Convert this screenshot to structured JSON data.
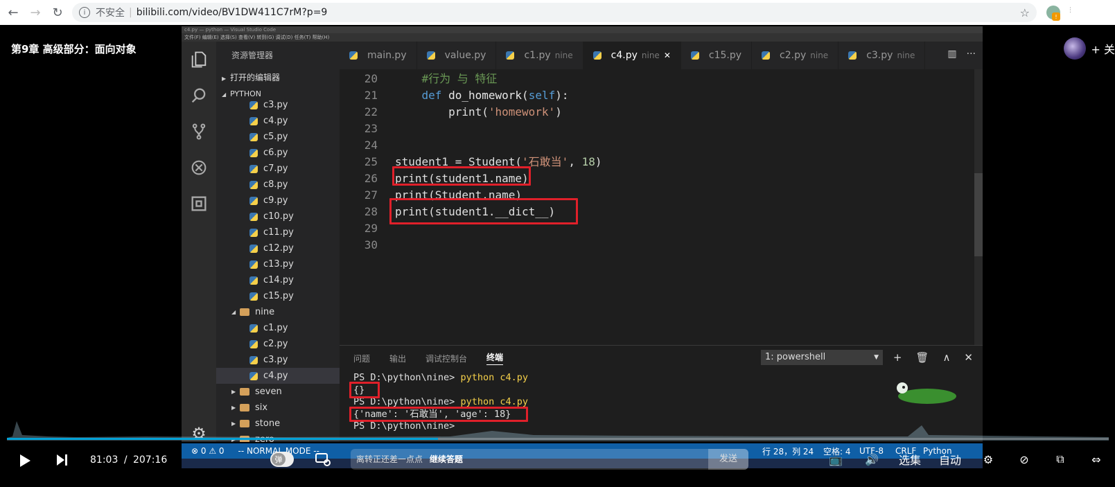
{
  "browser": {
    "insecure_label": "不安全",
    "url": "bilibili.com/video/BV1DW411C7rM?p=9"
  },
  "video": {
    "title": "第9章 高级部分：面向对象",
    "follow_label": "+ 关"
  },
  "vscode": {
    "titlebar": "c4.py — python — Visual Studio Code",
    "menubar": "文件(F)  编辑(E)  选择(S)  查看(V)  转到(G)  调试(D)  任务(T)  帮助(H)",
    "explorer_title": "资源管理器",
    "open_editors": "打开的编辑器",
    "workspace": "PYTHON",
    "tree": [
      {
        "label": "c3.py",
        "type": "py",
        "indent": 2
      },
      {
        "label": "c4.py",
        "type": "py",
        "indent": 2
      },
      {
        "label": "c5.py",
        "type": "py",
        "indent": 2
      },
      {
        "label": "c6.py",
        "type": "py",
        "indent": 2
      },
      {
        "label": "c7.py",
        "type": "py",
        "indent": 2
      },
      {
        "label": "c8.py",
        "type": "py",
        "indent": 2
      },
      {
        "label": "c9.py",
        "type": "py",
        "indent": 2
      },
      {
        "label": "c10.py",
        "type": "py",
        "indent": 2
      },
      {
        "label": "c11.py",
        "type": "py",
        "indent": 2
      },
      {
        "label": "c12.py",
        "type": "py",
        "indent": 2
      },
      {
        "label": "c13.py",
        "type": "py",
        "indent": 2
      },
      {
        "label": "c14.py",
        "type": "py",
        "indent": 2
      },
      {
        "label": "c15.py",
        "type": "py",
        "indent": 2
      },
      {
        "label": "nine",
        "type": "folder-open",
        "indent": 1
      },
      {
        "label": "c1.py",
        "type": "py",
        "indent": 2
      },
      {
        "label": "c2.py",
        "type": "py",
        "indent": 2
      },
      {
        "label": "c3.py",
        "type": "py",
        "indent": 2
      },
      {
        "label": "c4.py",
        "type": "py",
        "indent": 2,
        "active": true
      },
      {
        "label": "seven",
        "type": "folder",
        "indent": 1
      },
      {
        "label": "six",
        "type": "folder",
        "indent": 1
      },
      {
        "label": "stone",
        "type": "folder",
        "indent": 1
      },
      {
        "label": "zero",
        "type": "folder",
        "indent": 1
      }
    ],
    "tabs": [
      {
        "label": "main.py",
        "dir": ""
      },
      {
        "label": "value.py",
        "dir": ""
      },
      {
        "label": "c1.py",
        "dir": "nine"
      },
      {
        "label": "c4.py",
        "dir": "nine",
        "active": true
      },
      {
        "label": "c15.py",
        "dir": ""
      },
      {
        "label": "c2.py",
        "dir": "nine"
      },
      {
        "label": "c3.py",
        "dir": "nine"
      }
    ],
    "code_lines": [
      {
        "n": "20",
        "html": "    <span class='cmt'>#行为 与 特征</span>"
      },
      {
        "n": "21",
        "html": "    <span class='kw'>def</span> <span class='fn'>do_homework</span>(<span class='kw'>self</span>):"
      },
      {
        "n": "22",
        "html": "        print(<span class='str'>'homework'</span>)"
      },
      {
        "n": "23",
        "html": ""
      },
      {
        "n": "24",
        "html": ""
      },
      {
        "n": "25",
        "html": "student1 = Student(<span class='str'>'石敢当'</span>, <span class='num'>18</span>)"
      },
      {
        "n": "26",
        "html": "print(student1.name)"
      },
      {
        "n": "27",
        "html": "print(Student.name)"
      },
      {
        "n": "28",
        "html": "print(student1.__dict__)"
      },
      {
        "n": "29",
        "html": ""
      },
      {
        "n": "30",
        "html": ""
      }
    ],
    "panel_tabs": [
      "问题",
      "输出",
      "调试控制台",
      "终端"
    ],
    "terminal_select": "1: powershell",
    "terminal_lines": [
      {
        "prompt": "PS D:\\python\\nine> ",
        "cmd": "python c4.py"
      },
      {
        "prompt": "{}",
        "cmd": ""
      },
      {
        "prompt": "PS D:\\python\\nine> ",
        "cmd": "python c4.py"
      },
      {
        "prompt": "{'name': '石敢当', 'age': 18}",
        "cmd": ""
      },
      {
        "prompt": "PS D:\\python\\nine> ",
        "cmd": ""
      }
    ],
    "status": {
      "errors": "⊗ 0 ⚠ 0",
      "mode": "-- NORMAL MODE --",
      "position": "行 28，列 24",
      "spaces": "空格: 4",
      "encoding": "UTF-8",
      "eol": "CRLF",
      "language": "Python"
    }
  },
  "player": {
    "current_time": "81:03",
    "separator": "/",
    "total_time": "207:16",
    "progress_fraction": 0.391,
    "danmu_label": "弹",
    "danmu_placeholder": "离转正还差一点点",
    "danmu_link": "继续答题",
    "send_label": "发送",
    "episodes_label": "选集",
    "auto_label": "自动"
  },
  "colors": {
    "highlight": "#e0202a",
    "status_bar": "#0f5fa6",
    "progress": "#00a1d6"
  }
}
